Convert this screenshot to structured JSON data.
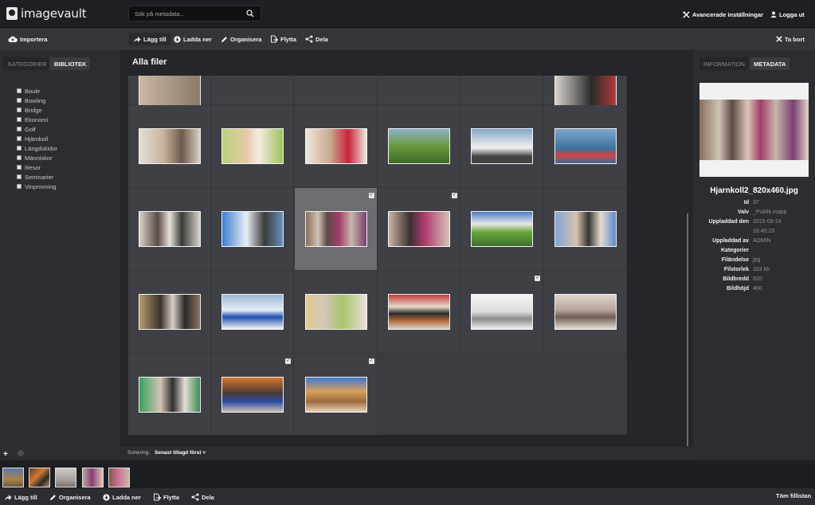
{
  "app": {
    "logo_text": "imagevault"
  },
  "search": {
    "placeholder": "Sök på metadata..."
  },
  "header": {
    "advanced_settings": "Avancerade inställningar",
    "logout": "Logga ut"
  },
  "toolbar": {
    "import": "Importera",
    "add": "Lägg till",
    "download": "Ladda ner",
    "organize": "Organisera",
    "move": "Flytta",
    "share": "Dela",
    "remove": "Ta bort"
  },
  "left_panel": {
    "tabs": [
      {
        "label": "KATEGORIER"
      },
      {
        "label": "BIBLIOTEK"
      }
    ],
    "categories": [
      "Boule",
      "Bowling",
      "Bridge",
      "Ekonomi",
      "Golf",
      "Hjärnkoll",
      "Längdskidor",
      "Människor",
      "Resor",
      "Seminarier",
      "Vinprovning"
    ]
  },
  "main": {
    "title": "Alla filer",
    "sort_label": "Sortering:",
    "sort_value": "Senast tillagd först"
  },
  "right_panel": {
    "tabs": [
      {
        "label": "INFORMATION"
      },
      {
        "label": "METADATA"
      }
    ],
    "filename": "Hjarnkoll2_820x460.jpg",
    "metadata": [
      {
        "key": "Id",
        "value": "37"
      },
      {
        "key": "Valv",
        "value": "_Publik mapp"
      },
      {
        "key": "Uppladdad den",
        "value": "2015-09-24"
      },
      {
        "key": "",
        "value": "16:45:23"
      },
      {
        "key": "Uppladdad av",
        "value": "ADMIN"
      },
      {
        "key": "Kategorier",
        "value": ""
      },
      {
        "key": "Filändelse",
        "value": "jpg"
      },
      {
        "key": "Filstorlek",
        "value": "333 kb"
      },
      {
        "key": "Bildbredd",
        "value": "820"
      },
      {
        "key": "Bildhöjd",
        "value": "460"
      }
    ]
  },
  "bottom_bar": {
    "add": "Lägg till",
    "organize": "Organisera",
    "download": "Ladda ner",
    "move": "Flytta",
    "share": "Dela",
    "empty": "Töm fillistan"
  },
  "colors": {
    "topbar": "#1e1f22",
    "panel": "#2c2d31",
    "grid_cell": "#3f4045",
    "selected_cell": "#6c6d72",
    "accent_text": "#ffffff"
  }
}
